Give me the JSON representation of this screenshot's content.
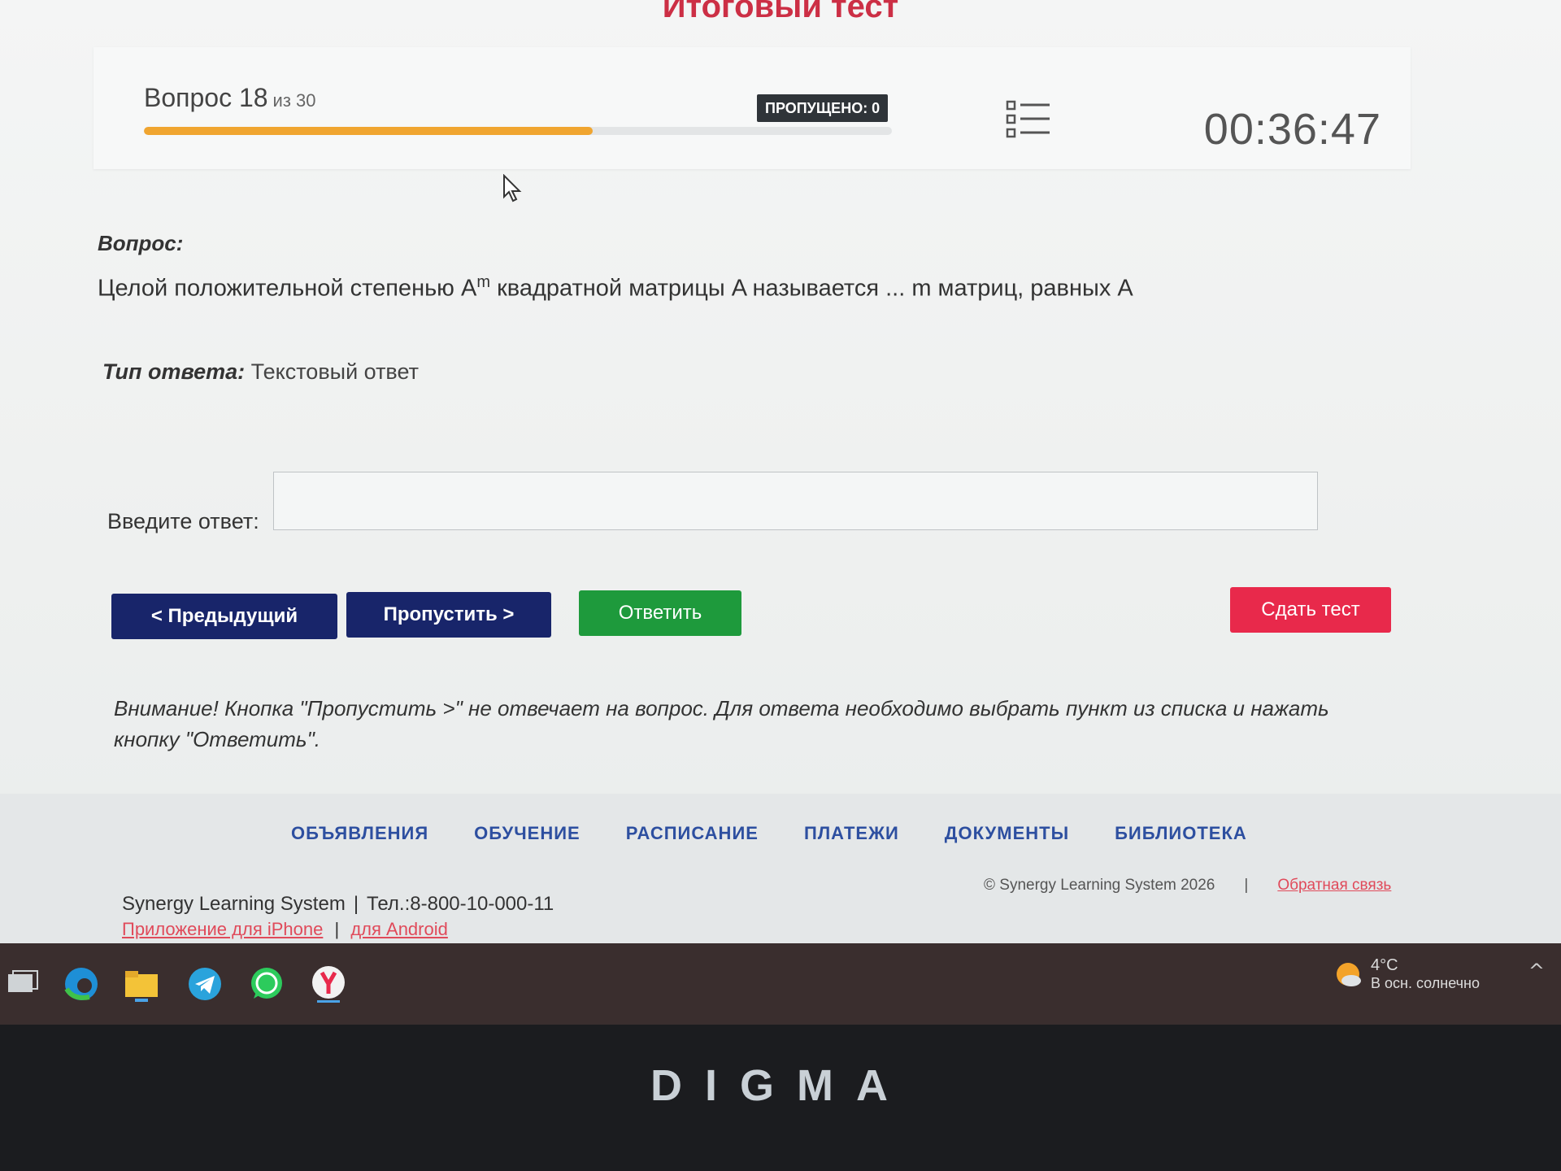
{
  "page": {
    "title": "Итоговый тест"
  },
  "header": {
    "question_label": "Вопрос 18",
    "question_of": "из 30",
    "progress": 0.6,
    "skipped_badge": "ПРОПУЩЕНО: 0",
    "list_icon": "list-icon",
    "timer": "00:36:47"
  },
  "question": {
    "label": "Вопрос:",
    "text_before": "Целой положительной степенью A",
    "superscript": "m",
    "text_after": " квадратной матрицы A называется ... m матриц, равных A"
  },
  "answer_type": {
    "label": "Тип ответа:",
    "value": " Текстовый ответ"
  },
  "answer_input": {
    "label": "Введите ответ:",
    "value": ""
  },
  "buttons": {
    "prev": "< Предыдущий",
    "skip": "Пропустить >",
    "answer": "Ответить",
    "submit": "Сдать тест"
  },
  "colors": {
    "accent_red": "#cc2f45",
    "nav_blue": "#18256a",
    "answer_green": "#1e9a3c",
    "submit_red": "#e8294b",
    "progress_orange": "#f0a530"
  },
  "warning": "Внимание! Кнопка \"Пропустить >\" не отвечает на вопрос. Для ответа необходимо выбрать пункт из списка и нажать кнопку \"Ответить\".",
  "footer": {
    "nav": [
      "ОБЪЯВЛЕНИЯ",
      "ОБУЧЕНИЕ",
      "РАСПИСАНИЕ",
      "ПЛАТЕЖИ",
      "ДОКУМЕНТЫ",
      "БИБЛИОТЕКА"
    ],
    "company": "Synergy Learning System",
    "phone": "Тел.:8-800-10-000-11",
    "app_iphone": "Приложение для iPhone",
    "app_android": "для Android",
    "copyright": "© Synergy Learning System 2026",
    "divider": "|",
    "feedback": "Обратная связь"
  },
  "taskbar": {
    "icons": [
      "task-view-icon",
      "edge-icon",
      "file-explorer-icon",
      "telegram-icon",
      "whatsapp-icon",
      "yandex-browser-icon"
    ],
    "weather_temp": "4°C",
    "weather_desc": "В осн. солнечно",
    "tray_chevron": "^"
  },
  "bezel": {
    "brand": "DIGMA"
  }
}
